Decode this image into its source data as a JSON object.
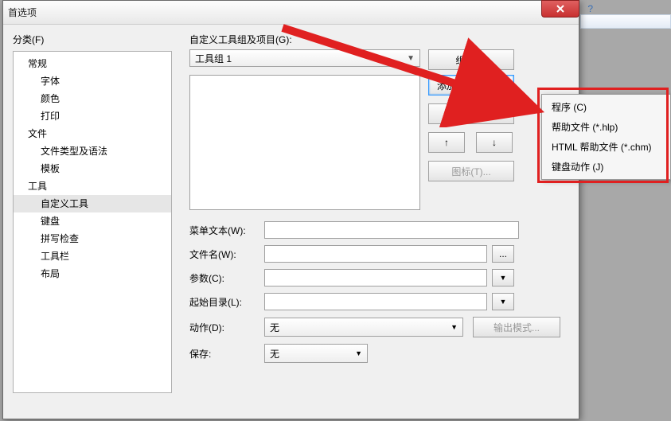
{
  "dialog": {
    "title": "首选项",
    "category_label": "分类(F)",
    "tree": [
      {
        "label": "常规",
        "level": 0
      },
      {
        "label": "字体",
        "level": 1
      },
      {
        "label": "颜色",
        "level": 1
      },
      {
        "label": "打印",
        "level": 1
      },
      {
        "label": "文件",
        "level": 0
      },
      {
        "label": "文件类型及语法",
        "level": 1
      },
      {
        "label": "模板",
        "level": 1
      },
      {
        "label": "工具",
        "level": 0
      },
      {
        "label": "自定义工具",
        "level": 1,
        "selected": true
      },
      {
        "label": "键盘",
        "level": 1
      },
      {
        "label": "拼写检查",
        "level": 1
      },
      {
        "label": "工具栏",
        "level": 1
      },
      {
        "label": "布局",
        "level": 1
      }
    ],
    "groups_label": "自定义工具组及项目(G):",
    "group_combo": "工具组 1",
    "groupname_btn": "组名(Z)",
    "add_btn": "添加",
    "add_chev": ">",
    "delete_btn": "删除(S)",
    "up_btn": "↑",
    "down_btn": "↓",
    "icon_btn": "图标(T)...",
    "menu_text_label": "菜单文本(W):",
    "filename_label": "文件名(W):",
    "browse_btn": "...",
    "args_label": "参数(C):",
    "startdir_label": "起始目录(L):",
    "action_label": "动作(D):",
    "action_value": "无",
    "output_btn": "输出模式...",
    "save_label": "保存:",
    "save_value": "无"
  },
  "context_menu": {
    "items": [
      "程序 (C)",
      "帮助文件 (*.hlp)",
      "HTML 帮助文件 (*.chm)",
      "键盘动作 (J)"
    ]
  }
}
